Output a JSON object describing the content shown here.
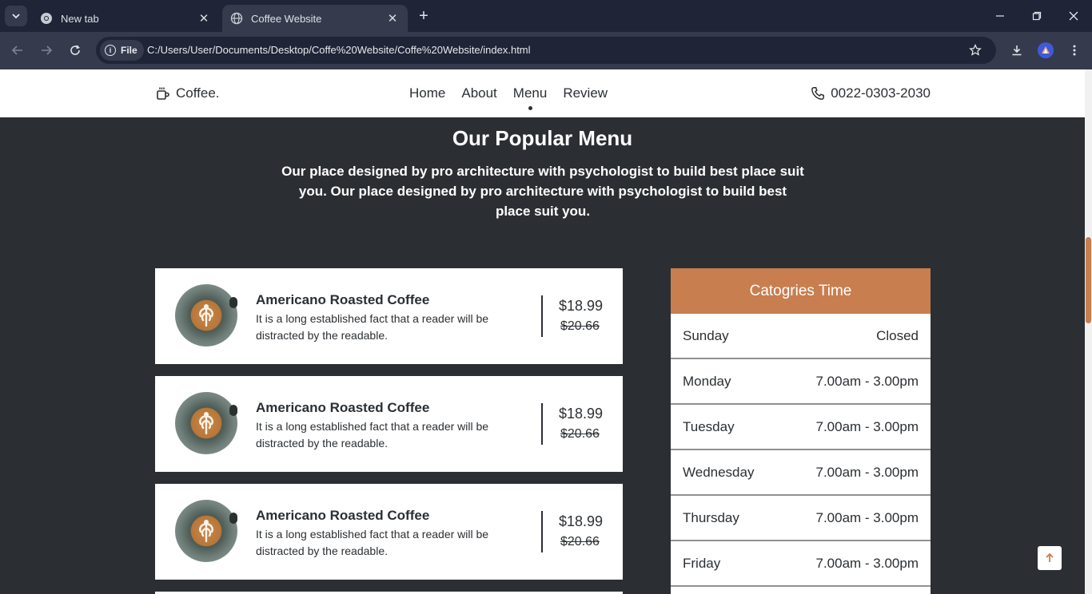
{
  "browser": {
    "tabs": [
      {
        "title": "New tab",
        "active": false
      },
      {
        "title": "Coffee Website",
        "active": true
      }
    ],
    "address_chip": "File",
    "url": "C:/Users/User/Documents/Desktop/Coffe%20Website/Coffe%20Website/index.html"
  },
  "header": {
    "brand": "Coffee.",
    "nav": [
      "Home",
      "About",
      "Menu",
      "Review"
    ],
    "active_nav": "Menu",
    "phone": "0022-0303-2030"
  },
  "section": {
    "title": "Our Popular Menu",
    "description": "Our place designed by pro architecture with psychologist to build best place suit you. Our place designed by pro architecture with psychologist to build best place suit you."
  },
  "menu_items": [
    {
      "name": "Americano Roasted Coffee",
      "description": "It is a long established fact that a reader will be distracted by the readable.",
      "price": "$18.99",
      "old_price": "$20.66"
    },
    {
      "name": "Americano Roasted Coffee",
      "description": "It is a long established fact that a reader will be distracted by the readable.",
      "price": "$18.99",
      "old_price": "$20.66"
    },
    {
      "name": "Americano Roasted Coffee",
      "description": "It is a long established fact that a reader will be distracted by the readable.",
      "price": "$18.99",
      "old_price": "$20.66"
    }
  ],
  "hours": {
    "title": "Catogries Time",
    "rows": [
      {
        "day": "Sunday",
        "time": "Closed"
      },
      {
        "day": "Monday",
        "time": "7.00am - 3.00pm"
      },
      {
        "day": "Tuesday",
        "time": "7.00am - 3.00pm"
      },
      {
        "day": "Wednesday",
        "time": "7.00am - 3.00pm"
      },
      {
        "day": "Thursday",
        "time": "7.00am - 3.00pm"
      },
      {
        "day": "Friday",
        "time": "7.00am - 3.00pm"
      }
    ]
  },
  "colors": {
    "accent": "#c87e4f",
    "page_bg": "#2b2f33",
    "card_bg": "#ffffff",
    "browser_frame": "#1f2436"
  }
}
